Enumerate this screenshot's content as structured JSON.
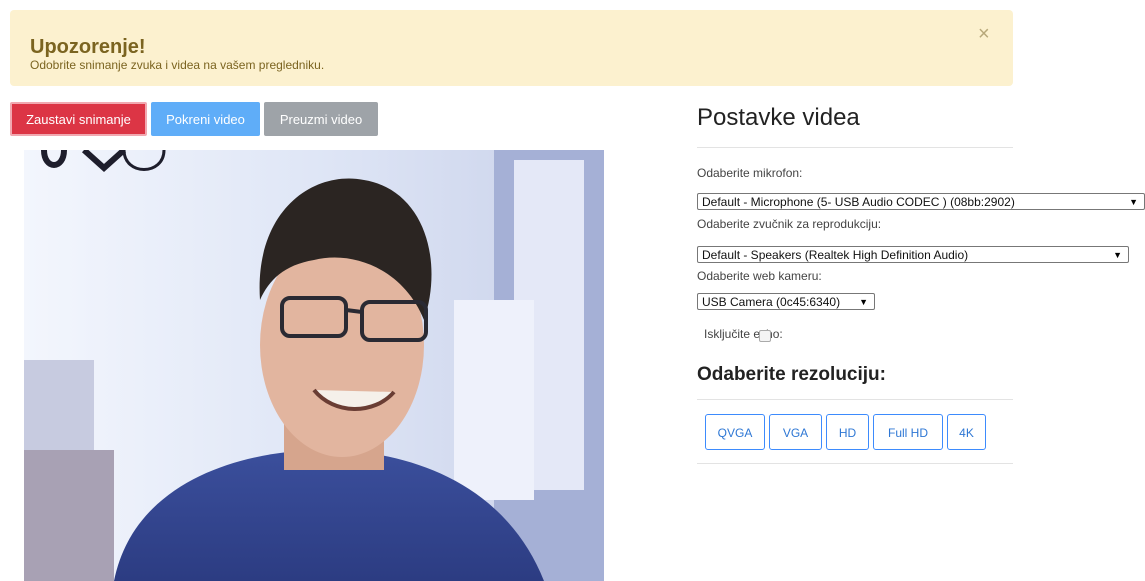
{
  "alert": {
    "title": "Upozorenje!",
    "message": "Odobrite snimanje zvuka i videa na vašem pregledniku.",
    "close": "×"
  },
  "toolbar": {
    "stop_label": "Zaustavi snimanje",
    "start_label": "Pokreni video",
    "download_label": "Preuzmi video"
  },
  "settings": {
    "title": "Postavke videa",
    "mic_label": "Odaberite mikrofon:",
    "mic_value": "Default - Microphone (5- USB Audio CODEC ) (08bb:2902)",
    "speaker_label": "Odaberite zvučnik za reprodukciju:",
    "speaker_value": "Default - Speakers (Realtek High Definition Audio)",
    "camera_label": "Odaberite web kameru:",
    "camera_value": "USB Camera (0c45:6340)",
    "echo_label": "Isključite echo:",
    "resolution_title": "Odaberite rezoluciju:",
    "resolutions": [
      "QVGA",
      "VGA",
      "HD",
      "Full HD",
      "4K"
    ],
    "dropdown_arrow": "▼"
  },
  "colors": {
    "danger": "#dc3545",
    "primary": "#5fadf8",
    "secondary": "#9ea3a8",
    "alert_bg": "#fcf1cf",
    "alert_text": "#7b6420",
    "outline_blue": "#3d8bfd"
  }
}
